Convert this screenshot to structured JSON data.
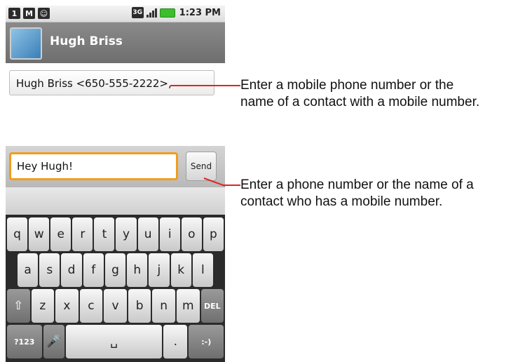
{
  "status_bar": {
    "left_icons": [
      "1",
      "M",
      "☺"
    ],
    "network": "3G",
    "time": "1:23 PM"
  },
  "title_bar": {
    "title": "Hugh Briss"
  },
  "recipient": {
    "value": "Hugh Briss <650-555-2222>,"
  },
  "compose": {
    "message": "Hey Hugh!",
    "send_label": "Send"
  },
  "keyboard": {
    "row1": [
      "q",
      "w",
      "e",
      "r",
      "t",
      "y",
      "u",
      "i",
      "o",
      "p"
    ],
    "row2": [
      "a",
      "s",
      "d",
      "f",
      "g",
      "h",
      "j",
      "k",
      "l"
    ],
    "row3_letters": [
      "z",
      "x",
      "c",
      "v",
      "b",
      "n",
      "m"
    ],
    "shift_symbol": "⇧",
    "del_label": "DEL",
    "mode_key": "?123",
    "mic_symbol": "🎤",
    "space_symbol": "␣",
    "period": ".",
    "smiley": ":-)"
  },
  "annotations": {
    "recipient_note_line1": "Enter a mobile phone number or the",
    "recipient_note_line2": "name of a contact with a mobile number.",
    "send_note_line1": "Enter a phone number or the name of a",
    "send_note_line2": "contact who has a mobile number."
  },
  "colors": {
    "focus_accent": "#f39c1c",
    "annotation_line": "#e02424",
    "battery": "#3bbf2b"
  }
}
